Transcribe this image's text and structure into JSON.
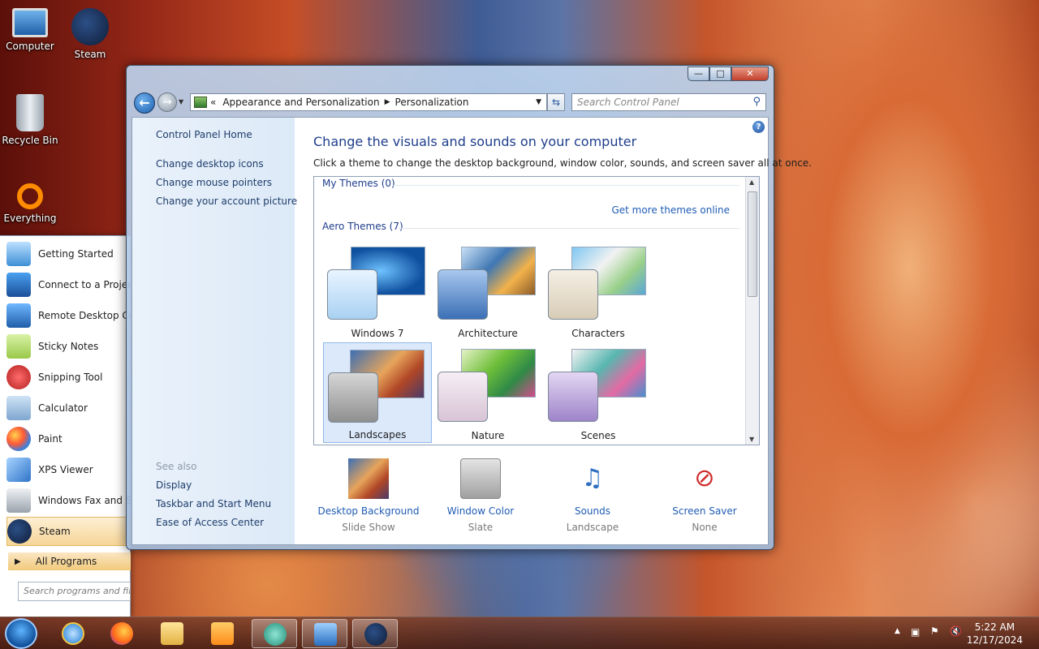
{
  "desktop": {
    "icons": [
      {
        "label": "Computer"
      },
      {
        "label": "Steam"
      },
      {
        "label": "Recycle Bin"
      },
      {
        "label": "Everything"
      }
    ]
  },
  "start_menu": {
    "items": [
      {
        "label": "Getting Started"
      },
      {
        "label": "Connect to a Projector"
      },
      {
        "label": "Remote Desktop Connection"
      },
      {
        "label": "Sticky Notes"
      },
      {
        "label": "Snipping Tool"
      },
      {
        "label": "Calculator"
      },
      {
        "label": "Paint"
      },
      {
        "label": "XPS Viewer"
      },
      {
        "label": "Windows Fax and Scan"
      },
      {
        "label": "Steam"
      }
    ],
    "all_programs": "All Programs",
    "search_placeholder": "Search programs and files"
  },
  "window": {
    "address": {
      "prefix": "«",
      "crumb1": "Appearance and Personalization",
      "crumb2": "Personalization"
    },
    "search_placeholder": "Search Control Panel",
    "left_pane": {
      "home": "Control Panel Home",
      "links": [
        "Change desktop icons",
        "Change mouse pointers",
        "Change your account picture"
      ],
      "see_also_title": "See also",
      "see_also": [
        "Display",
        "Taskbar and Start Menu",
        "Ease of Access Center"
      ]
    },
    "heading": "Change the visuals and sounds on your computer",
    "subheading": "Click a theme to change the desktop background, window color, sounds, and screen saver all at once.",
    "themes": {
      "my_themes": "My Themes (0)",
      "get_more": "Get more themes online",
      "aero_themes": "Aero Themes (7)",
      "items": [
        {
          "label": "Windows 7",
          "selected": false
        },
        {
          "label": "Architecture",
          "selected": false
        },
        {
          "label": "Characters",
          "selected": false
        },
        {
          "label": "Landscapes",
          "selected": true
        },
        {
          "label": "Nature",
          "selected": false
        },
        {
          "label": "Scenes",
          "selected": false
        }
      ]
    },
    "bottom": [
      {
        "label": "Desktop Background",
        "value": "Slide Show",
        "icon": "desktop-background-icon"
      },
      {
        "label": "Window Color",
        "value": "Slate",
        "icon": "window-color-icon"
      },
      {
        "label": "Sounds",
        "value": "Landscape",
        "icon": "sounds-icon"
      },
      {
        "label": "Screen Saver",
        "value": "None",
        "icon": "screen-saver-icon"
      }
    ]
  },
  "taskbar": {
    "clock_time": "5:22 AM",
    "clock_date": "12/17/2024"
  }
}
